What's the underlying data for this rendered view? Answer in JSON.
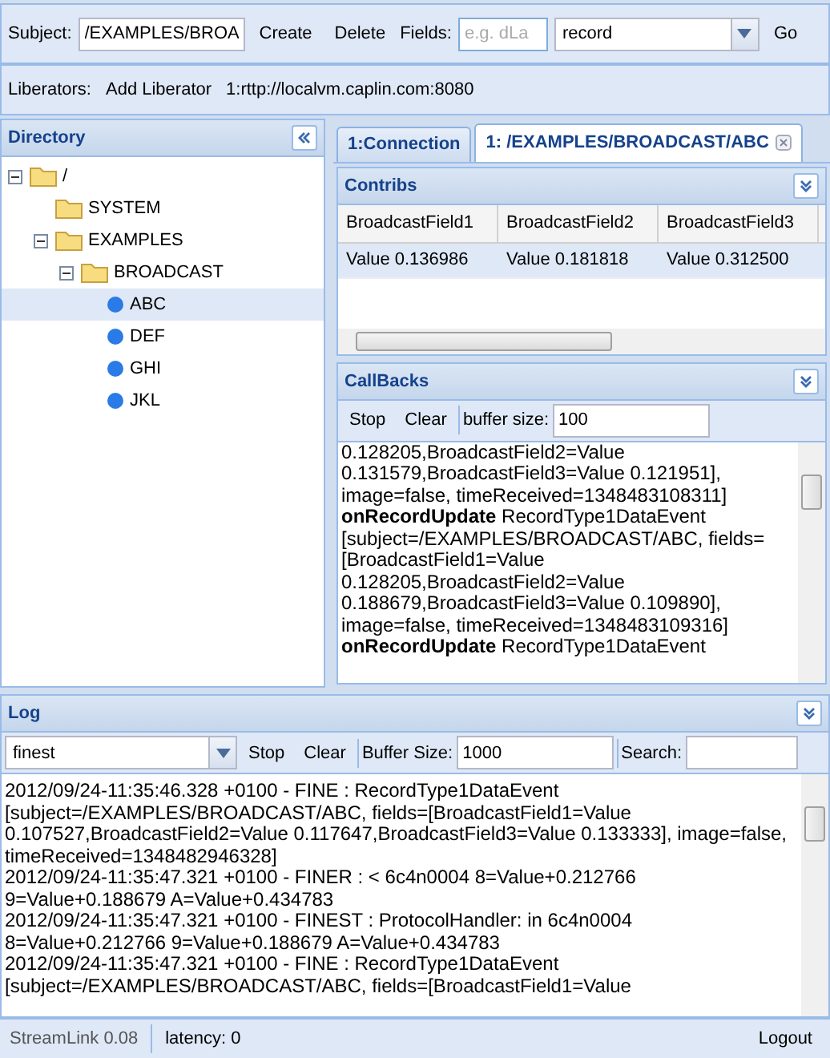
{
  "toolbar": {
    "subject_label": "Subject:",
    "subject_value": "/EXAMPLES/BROA",
    "create": "Create",
    "delete": "Delete",
    "fields_label": "Fields:",
    "fields_placeholder": "e.g. dLa",
    "type_value": "record",
    "go": "Go"
  },
  "liberators": {
    "label": "Liberators:",
    "add": "Add Liberator",
    "connection": "1:rttp://localvm.caplin.com:8080"
  },
  "directory": {
    "title": "Directory",
    "tree": [
      {
        "label": "/",
        "kind": "folder",
        "expanded": true,
        "selected": false,
        "children": [
          {
            "label": "SYSTEM",
            "kind": "folder",
            "selected": false
          },
          {
            "label": "EXAMPLES",
            "kind": "folder",
            "expanded": true,
            "selected": false,
            "children": [
              {
                "label": "BROADCAST",
                "kind": "folder",
                "expanded": true,
                "selected": false,
                "children": [
                  {
                    "label": "ABC",
                    "kind": "leaf",
                    "selected": true
                  },
                  {
                    "label": "DEF",
                    "kind": "leaf",
                    "selected": false
                  },
                  {
                    "label": "GHI",
                    "kind": "leaf",
                    "selected": false
                  },
                  {
                    "label": "JKL",
                    "kind": "leaf",
                    "selected": false
                  }
                ]
              }
            ]
          }
        ]
      }
    ]
  },
  "tabs": [
    {
      "label": "1:Connection",
      "selected": false,
      "closable": false
    },
    {
      "label": "1: /EXAMPLES/BROADCAST/ABC",
      "selected": true,
      "closable": true
    }
  ],
  "contribs": {
    "title": "Contribs",
    "columns": [
      "BroadcastField1",
      "BroadcastField2",
      "BroadcastField3"
    ],
    "rows": [
      [
        "Value 0.136986",
        "Value 0.181818",
        "Value 0.312500"
      ]
    ]
  },
  "callbacks": {
    "title": "CallBacks",
    "stop": "Stop",
    "clear": "Clear",
    "buffer_label": "buffer size:",
    "buffer_value": "100",
    "entries": [
      "0.128205,BroadcastField2=Value 0.131579,BroadcastField3=Value 0.121951], image=false, timeReceived=1348483108311]",
      "**onRecordUpdate** RecordType1DataEvent [subject=/EXAMPLES/BROADCAST/ABC, fields=[BroadcastField1=Value 0.128205,BroadcastField2=Value 0.188679,BroadcastField3=Value 0.109890], image=false, timeReceived=1348483109316]",
      "**onRecordUpdate** RecordType1DataEvent"
    ]
  },
  "log": {
    "title": "Log",
    "level": "finest",
    "stop": "Stop",
    "clear": "Clear",
    "buffer_label": "Buffer Size:",
    "buffer_value": "1000",
    "search_label": "Search:",
    "entries": [
      "2012/09/24-11:35:46.328 +0100 - FINE : RecordType1DataEvent [subject=/EXAMPLES/BROADCAST/ABC, fields=[BroadcastField1=Value 0.107527,BroadcastField2=Value 0.117647,BroadcastField3=Value 0.133333], image=false, timeReceived=1348482946328]",
      "2012/09/24-11:35:47.321 +0100 - FINER : < 6c4n0004 8=Value+0.212766 9=Value+0.188679 A=Value+0.434783",
      "2012/09/24-11:35:47.321 +0100 - FINEST : ProtocolHandler: in 6c4n0004 8=Value+0.212766 9=Value+0.188679 A=Value+0.434783",
      "2012/09/24-11:35:47.321 +0100 - FINE : RecordType1DataEvent [subject=/EXAMPLES/BROADCAST/ABC, fields=[BroadcastField1=Value"
    ]
  },
  "status": {
    "version": "StreamLink 0.08",
    "latency": "latency: 0",
    "logout": "Logout"
  }
}
